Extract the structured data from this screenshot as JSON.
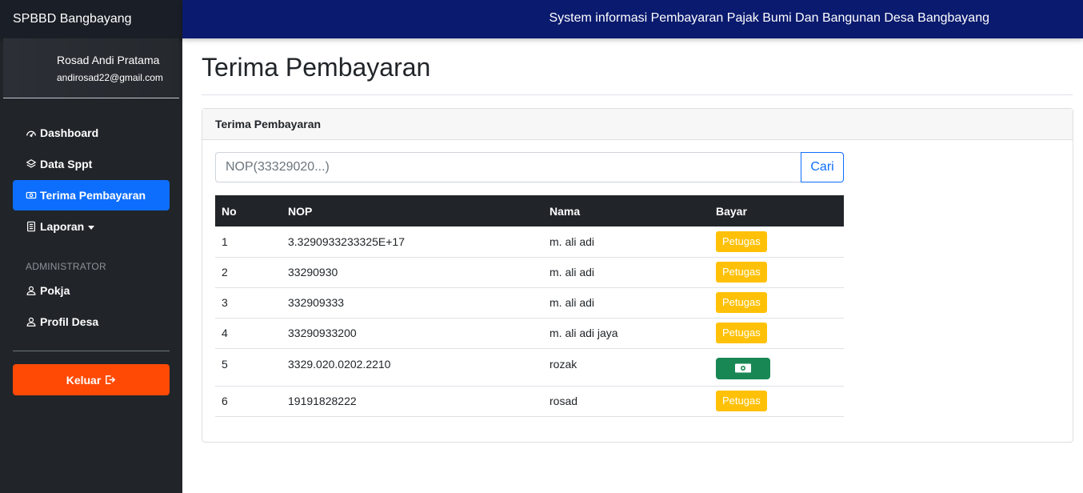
{
  "brand": "SPBBD Bangbayang",
  "user": {
    "name": "Rosad Andi Pratama",
    "email": "andirosad22@gmail.com"
  },
  "nav": {
    "dashboard": "Dashboard",
    "data_sppt": "Data Sppt",
    "terima_pembayaran": "Terima Pembayaran",
    "laporan": "Laporan",
    "admin_header": "ADMINISTRATOR",
    "pokja": "Pokja",
    "profil_desa": "Profil Desa",
    "logout": "Keluar"
  },
  "topbar": {
    "title": "System informasi Pembayaran Pajak Bumi Dan Bangunan Desa Bangbayang"
  },
  "page": {
    "title": "Terima Pembayaran"
  },
  "card": {
    "header": "Terima Pembayaran"
  },
  "search": {
    "placeholder": "NOP(33329020...)",
    "button": "Cari"
  },
  "table": {
    "headers": [
      "No",
      "NOP",
      "Nama",
      "Bayar"
    ],
    "rows": [
      {
        "no": "1",
        "nop": "3.3290933233325E+17",
        "nama": "m. ali adi",
        "bayar": "Petugas"
      },
      {
        "no": "2",
        "nop": "33290930",
        "nama": "m. ali adi",
        "bayar": "Petugas"
      },
      {
        "no": "3",
        "nop": "332909333",
        "nama": "m. ali adi",
        "bayar": "Petugas"
      },
      {
        "no": "4",
        "nop": "33290933200",
        "nama": "m. ali adi jaya",
        "bayar": "Petugas"
      },
      {
        "no": "5",
        "nop": "3329.020.0202.2210",
        "nama": "rozak",
        "bayar": "pay-icon"
      },
      {
        "no": "6",
        "nop": "19191828222",
        "nama": "rosad",
        "bayar": "Petugas"
      }
    ]
  },
  "colors": {
    "accent": "#0d6efd",
    "topbar": "#0a1a6e",
    "sidebar": "#212529",
    "logout": "#ff4a06",
    "badge": "#ffc107",
    "pay": "#198754"
  }
}
